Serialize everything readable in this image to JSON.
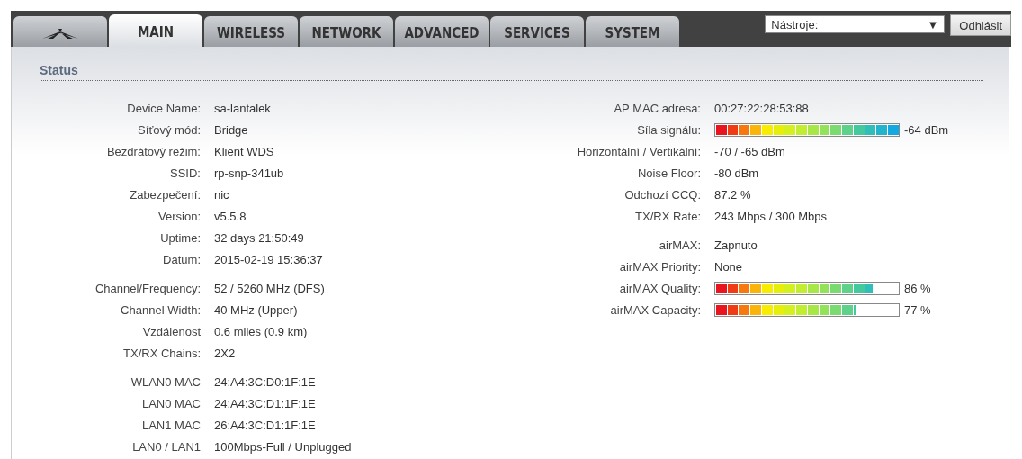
{
  "tabs": [
    {
      "kind": "logo",
      "selected": false
    },
    {
      "kind": "text",
      "label": "MAIN",
      "selected": true
    },
    {
      "kind": "text",
      "label": "WIRELESS",
      "selected": false
    },
    {
      "kind": "text",
      "label": "NETWORK",
      "selected": false
    },
    {
      "kind": "text",
      "label": "ADVANCED",
      "selected": false
    },
    {
      "kind": "text",
      "label": "SERVICES",
      "selected": false
    },
    {
      "kind": "text",
      "label": "SYSTEM",
      "selected": false
    }
  ],
  "tools_dropdown": {
    "value": "Nástroje:",
    "arrow": "▼"
  },
  "logout_button": "Odhlásit",
  "section_title": "Status",
  "left_groups": [
    [
      {
        "label": "Device Name:",
        "value": "sa-lantalek"
      },
      {
        "label": "Síťový mód:",
        "value": "Bridge"
      },
      {
        "label": "Bezdrátový režim:",
        "value": "Klient WDS"
      },
      {
        "label": "SSID:",
        "value": "rp-snp-341ub"
      },
      {
        "label": "Zabezpečení:",
        "value": "nic"
      },
      {
        "label": "Version:",
        "value": "v5.5.8"
      },
      {
        "label": "Uptime:",
        "value": "32 days 21:50:49"
      },
      {
        "label": "Datum:",
        "value": "2015-02-19 15:36:37"
      }
    ],
    [
      {
        "label": "Channel/Frequency:",
        "value": "52 / 5260 MHz (DFS)"
      },
      {
        "label": "Channel Width:",
        "value": "40 MHz (Upper)"
      },
      {
        "label": "Vzdálenost",
        "value": "0.6 miles (0.9 km)"
      },
      {
        "label": "TX/RX Chains:",
        "value": "2X2"
      }
    ],
    [
      {
        "label": "WLAN0 MAC",
        "value": "24:A4:3C:D0:1F:1E"
      },
      {
        "label": "LAN0 MAC",
        "value": "24:A4:3C:D1:1F:1E"
      },
      {
        "label": "LAN1 MAC",
        "value": "26:A4:3C:D1:1F:1E"
      },
      {
        "label": "LAN0 / LAN1",
        "value": "100Mbps-Full / Unplugged"
      }
    ]
  ],
  "right_groups": [
    [
      {
        "kind": "text",
        "label": "AP MAC adresa:",
        "value": "00:27:22:28:53:88"
      },
      {
        "kind": "meter",
        "label": "Síla signálu:",
        "level": 1.0,
        "reading": "-64 dBm"
      },
      {
        "kind": "text",
        "label": "Horizontální / Vertikální:",
        "value": "-70 / -65 dBm"
      },
      {
        "kind": "text",
        "label": "Noise Floor:",
        "value": "-80 dBm"
      },
      {
        "kind": "text",
        "label": "Odchozí CCQ:",
        "value": "87.2 %"
      },
      {
        "kind": "text",
        "label": "TX/RX Rate:",
        "value": "243 Mbps / 300 Mbps"
      }
    ],
    [
      {
        "kind": "text",
        "label": "airMAX:",
        "value": "Zapnuto"
      },
      {
        "kind": "text",
        "label": "airMAX Priority:",
        "value": "None"
      },
      {
        "kind": "meter",
        "label": "airMAX Quality:",
        "level": 0.86,
        "reading": "86 %"
      },
      {
        "kind": "meter",
        "label": "airMAX Capacity:",
        "level": 0.77,
        "reading": "77 %"
      }
    ]
  ]
}
